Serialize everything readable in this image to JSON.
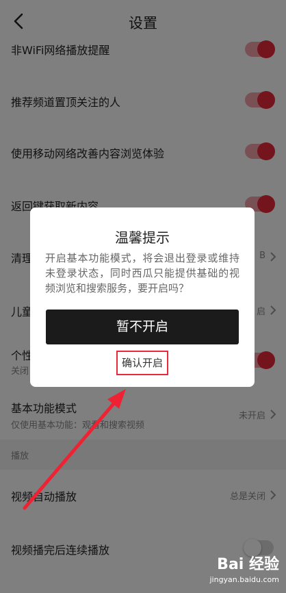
{
  "header": {
    "title": "设置"
  },
  "settings": [
    {
      "label": "非WiFi网络播放提醒",
      "toggle": "on"
    },
    {
      "label": "推荐频道置顶关注的人",
      "toggle": "on"
    },
    {
      "label": "使用移动网络改善内容浏览体验",
      "toggle": "on"
    },
    {
      "label": "返回键获取新内容",
      "toggle": "on"
    },
    {
      "label": "清理",
      "value": "B"
    },
    {
      "label": "儿童",
      "value": "启"
    },
    {
      "label": "个性",
      "sub": "关闭",
      "toggle": "on"
    },
    {
      "label": "基本功能模式",
      "sub": "仅使用基本功能：观看和搜索视频",
      "value": "未开启"
    }
  ],
  "section": {
    "label": "播放"
  },
  "playback": [
    {
      "label": "视频自动播放",
      "value": "总是关闭"
    },
    {
      "label": "视频播完后连续播放",
      "toggle": "off"
    }
  ],
  "dialog": {
    "title": "温馨提示",
    "body": "开启基本功能模式，将会退出登录或维持未登录状态，同时西瓜只能提供基础的视频浏览和搜索服务，要开启吗？",
    "primary_label": "暂不开启",
    "confirm_label": "确认开启"
  },
  "watermark": {
    "main": "Bai  经验",
    "sub": "jingyan.baidu.com"
  },
  "colors": {
    "accent": "#e8293b",
    "overlay": "rgba(0,0,0,0.5)",
    "primary_button": "#1b1b1b"
  },
  "icons": [
    "back-arrow-icon",
    "chevron-right-icon",
    "toggle-switch",
    "annotation-arrow",
    "baidu-paw-icon"
  ]
}
